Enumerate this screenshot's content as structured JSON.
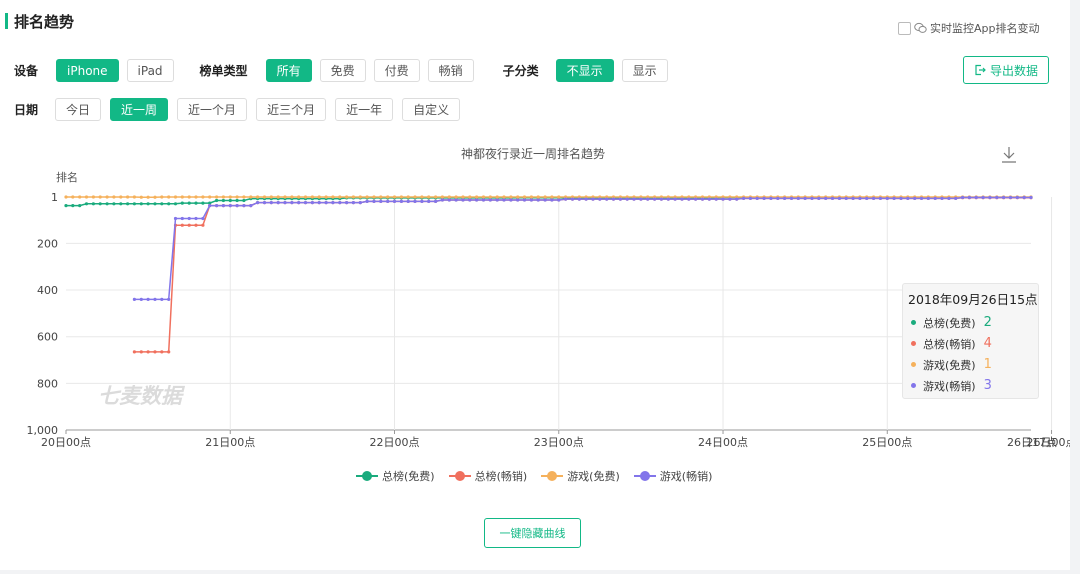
{
  "page": {
    "title": "排名趋势",
    "monitor_label": "实时监控App排名变动",
    "export_label": "导出数据",
    "hide_label": "一键隐藏曲线",
    "accent": "#12b886"
  },
  "filters": {
    "device_label": "设备",
    "devices": [
      "iPhone",
      "iPad"
    ],
    "device_active": 0,
    "list_type_label": "榜单类型",
    "list_types": [
      "所有",
      "免费",
      "付费",
      "畅销"
    ],
    "list_type_active": 0,
    "subcat_label": "子分类",
    "subcat_options": [
      "不显示",
      "显示"
    ],
    "subcat_active": 0,
    "date_label": "日期",
    "dates": [
      "今日",
      "近一周",
      "近一个月",
      "近三个月",
      "近一年",
      "自定义"
    ],
    "date_active": 1
  },
  "tooltip": {
    "title": "2018年09月26日15点",
    "rows": [
      {
        "name": "总榜(免费)",
        "value": "2",
        "color": "#1aab7d"
      },
      {
        "name": "总榜(畅销)",
        "value": "4",
        "color": "#f0705e"
      },
      {
        "name": "游戏(免费)",
        "value": "1",
        "color": "#f5b15c"
      },
      {
        "name": "游戏(畅销)",
        "value": "3",
        "color": "#8275ea"
      }
    ]
  },
  "chart_data": {
    "type": "line",
    "title": "神都夜行录近一周排名趋势",
    "ylabel": "排名",
    "xlabel": "",
    "watermark": "七麦数据",
    "y_inverted": true,
    "ylim": [
      1,
      1000
    ],
    "yticks": [
      1,
      200,
      400,
      600,
      800,
      1000
    ],
    "ytick_labels": [
      "1",
      "200",
      "400",
      "600",
      "800",
      "1,000"
    ],
    "xlim": [
      0,
      141
    ],
    "xticks": [
      0,
      24,
      48,
      72,
      96,
      120,
      144
    ],
    "xtick_labels": [
      "20日00点",
      "21日00点",
      "22日00点",
      "23日00点",
      "24日00点",
      "25日00点",
      "26日00点"
    ],
    "end_label": "26日17点",
    "grid": true,
    "legend_position": "bottom",
    "series": [
      {
        "name": "总榜(免费)",
        "color": "#1aab7d",
        "points": [
          [
            0,
            38
          ],
          [
            2,
            38
          ],
          [
            3,
            30
          ],
          [
            16,
            30
          ],
          [
            17,
            27
          ],
          [
            21,
            27
          ],
          [
            22,
            16
          ],
          [
            26,
            16
          ],
          [
            27,
            8
          ],
          [
            40,
            8
          ],
          [
            41,
            5
          ],
          [
            65,
            5
          ],
          [
            66,
            4
          ],
          [
            95,
            4
          ],
          [
            96,
            3
          ],
          [
            141,
            2
          ]
        ]
      },
      {
        "name": "总榜(畅销)",
        "color": "#f0705e",
        "points": [
          [
            10,
            665
          ],
          [
            15,
            665
          ],
          [
            16,
            122
          ],
          [
            20,
            122
          ],
          [
            21,
            38
          ],
          [
            27,
            38
          ],
          [
            28,
            25
          ],
          [
            43,
            25
          ],
          [
            44,
            20
          ],
          [
            54,
            20
          ],
          [
            55,
            14
          ],
          [
            72,
            14
          ],
          [
            73,
            10
          ],
          [
            98,
            10
          ],
          [
            99,
            7
          ],
          [
            130,
            7
          ],
          [
            131,
            4
          ],
          [
            141,
            4
          ]
        ]
      },
      {
        "name": "游戏(免费)",
        "color": "#f5b15c",
        "points": [
          [
            0,
            1
          ],
          [
            10,
            1
          ],
          [
            11,
            2
          ],
          [
            13,
            2
          ],
          [
            14,
            1
          ],
          [
            141,
            1
          ]
        ]
      },
      {
        "name": "游戏(畅销)",
        "color": "#8275ea",
        "points": [
          [
            10,
            440
          ],
          [
            15,
            440
          ],
          [
            16,
            93
          ],
          [
            20,
            93
          ],
          [
            21,
            38
          ],
          [
            27,
            38
          ],
          [
            28,
            25
          ],
          [
            43,
            25
          ],
          [
            44,
            20
          ],
          [
            54,
            20
          ],
          [
            55,
            14
          ],
          [
            72,
            14
          ],
          [
            73,
            10
          ],
          [
            98,
            10
          ],
          [
            99,
            7
          ],
          [
            130,
            7
          ],
          [
            131,
            3
          ],
          [
            141,
            3
          ]
        ]
      }
    ]
  }
}
